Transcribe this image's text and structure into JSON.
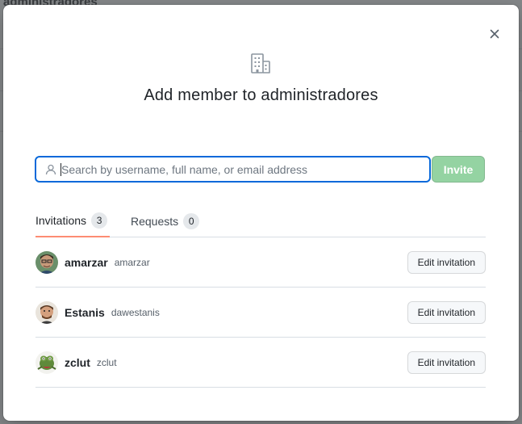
{
  "background": {
    "partial_text": "administradores"
  },
  "dialog": {
    "title": "Add member to administradores",
    "close_icon": "close-icon",
    "org_icon": "organization-icon",
    "search": {
      "placeholder": "Search by username, full name, or email address",
      "value": ""
    },
    "invite_label": "Invite",
    "colors": {
      "invite_bg": "#94d3a2",
      "focus_border": "#0969da",
      "tab_underline": "#fd8c73"
    }
  },
  "tabs": [
    {
      "label": "Invitations",
      "count": "3",
      "selected": true
    },
    {
      "label": "Requests",
      "count": "0",
      "selected": false
    }
  ],
  "invitations": [
    {
      "login": "amarzar",
      "name": "amarzar",
      "action": "Edit invitation"
    },
    {
      "login": "Estanis",
      "name": "dawestanis",
      "action": "Edit invitation"
    },
    {
      "login": "zclut",
      "name": "zclut",
      "action": "Edit invitation"
    }
  ]
}
